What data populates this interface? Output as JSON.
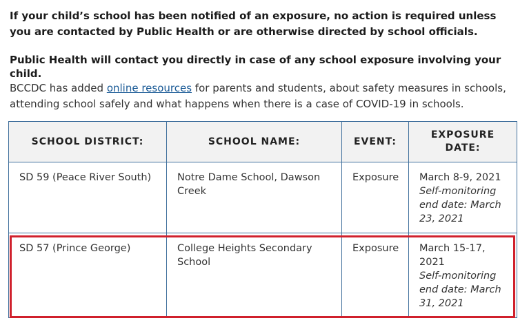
{
  "intro": {
    "notice": "If your child’s school has been notified of an exposure, no action is required unless you are contacted by Public Health or are otherwise directed by school officials.",
    "contact": "Public Health will contact you directly in case of any school exposure involving your child.",
    "resources_before": "BCCDC has added ",
    "resources_link": "online resources",
    "resources_after": " for parents and students, about safety measures in schools, attending school safely and what happens when there is a case of COVID-19 in schools."
  },
  "table": {
    "headers": [
      "SCHOOL DISTRICT:",
      "SCHOOL NAME:",
      "EVENT:",
      "EXPOSURE DATE:"
    ],
    "rows": [
      {
        "district": "SD 59 (Peace River South)",
        "school": "Notre Dame School, Dawson Creek",
        "event": "Exposure",
        "date": "March 8-9, 2021",
        "self_monitoring": "Self-monitoring end date: March 23, 2021"
      },
      {
        "district": "SD 57 (Prince George)",
        "school": "College Heights Secondary School",
        "event": "Exposure",
        "date": "March 15-17, 2021",
        "self_monitoring": "Self-monitoring end date: March 31, 2021"
      }
    ]
  },
  "highlight_color": "#d0202c",
  "link_color": "#1a5a96"
}
